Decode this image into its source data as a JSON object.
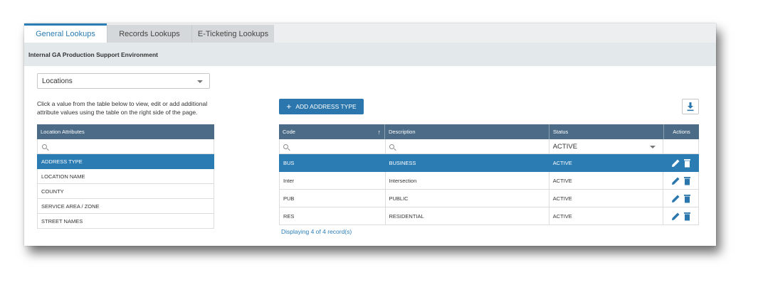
{
  "tabs": [
    {
      "label": "General Lookups",
      "active": true
    },
    {
      "label": "Records Lookups",
      "active": false
    },
    {
      "label": "E-Ticketing Lookups",
      "active": false
    }
  ],
  "environment": "Internal GA Production Support Environment",
  "lookup_select": {
    "value": "Locations"
  },
  "help_text": "Click a value from the table below to view, edit or add additional attribute values using the table on the right side of the page.",
  "attributes_table": {
    "header": "Location Attributes",
    "rows": [
      "ADDRESS TYPE",
      "LOCATION NAME",
      "COUNTY",
      "SERVICE AREA / ZONE",
      "STREET NAMES"
    ],
    "selected_index": 0
  },
  "add_button": {
    "label": "ADD ADDRESS TYPE"
  },
  "main_table": {
    "columns": [
      "Code",
      "Description",
      "Status",
      "Actions"
    ],
    "status_filter": "ACTIVE",
    "rows": [
      {
        "code": "BUS",
        "description": "BUSINESS",
        "status": "ACTIVE"
      },
      {
        "code": "Inter",
        "description": "Intersection",
        "status": "ACTIVE"
      },
      {
        "code": "PUB",
        "description": "PUBLIC",
        "status": "ACTIVE"
      },
      {
        "code": "RES",
        "description": "RESIDENTIAL",
        "status": "ACTIVE"
      }
    ],
    "selected_index": 0
  },
  "footer": "Displaying 4 of 4 record(s)",
  "colors": {
    "accent": "#2b77ad",
    "header": "#4b6b86",
    "selected": "#2c7cb4"
  },
  "icons": [
    "search-icon",
    "chevron-down-icon",
    "plus-icon",
    "download-icon",
    "sort-up-icon",
    "edit-icon",
    "delete-icon"
  ]
}
